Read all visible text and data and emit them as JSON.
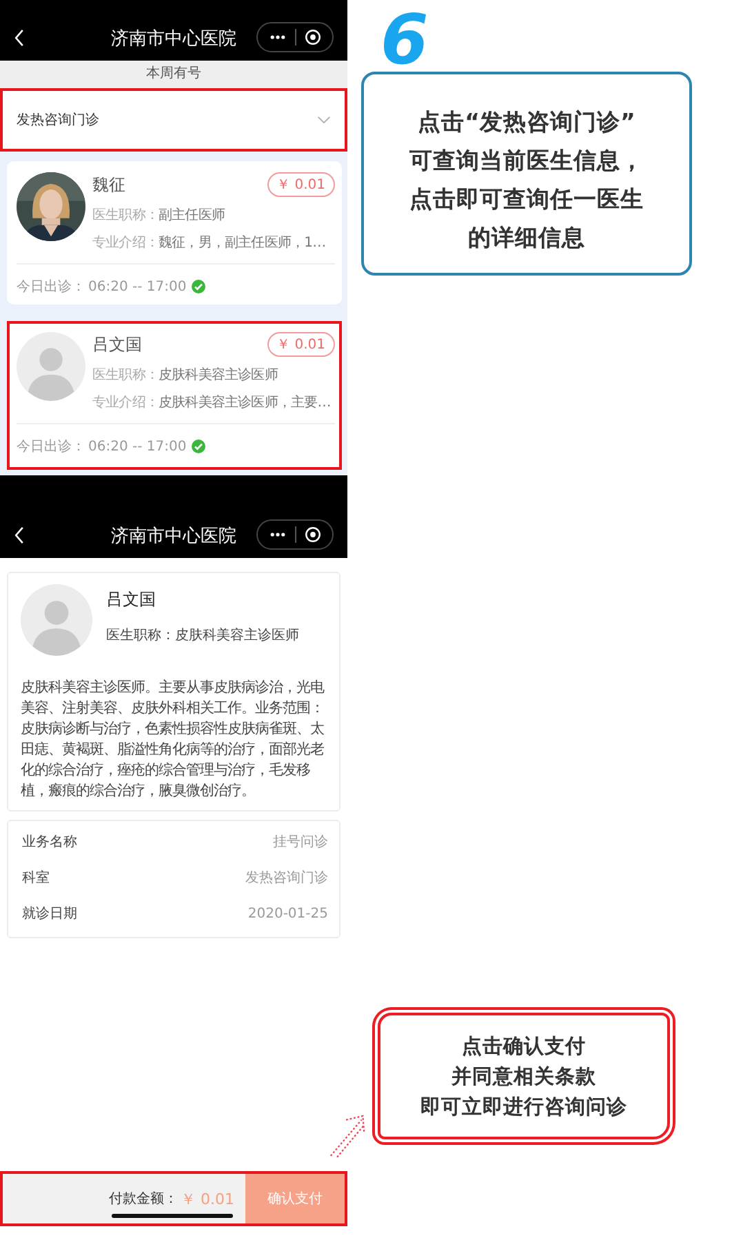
{
  "screens": [
    {
      "kind": "list",
      "nav_title": "济南市中心医院",
      "subheader": "本周有号",
      "dropdown": {
        "value": "发热咨询门诊",
        "highlighted": true
      },
      "doctors": [
        {
          "name": "魏征",
          "has_photo": true,
          "title_label": "医生职称：",
          "title": "副主任医师",
          "intro_label": "专业介绍：",
          "intro": "魏征，男，副主任医师，1…",
          "schedule_label": "今日出诊：",
          "schedule": "06:20 -- 17:00",
          "available": true,
          "price": "￥ 0.01",
          "highlighted": false
        },
        {
          "name": "吕文国",
          "has_photo": false,
          "title_label": "医生职称：",
          "title": "皮肤科美容主诊医师",
          "intro_label": "专业介绍：",
          "intro": "皮肤科美容主诊医师，主要…",
          "schedule_label": "今日出诊：",
          "schedule": "06:20 -- 17:00",
          "available": true,
          "price": "￥ 0.01",
          "highlighted": true
        }
      ]
    },
    {
      "kind": "detail",
      "nav_title": "济南市中心医院",
      "doctor": {
        "name": "吕文国",
        "has_photo": false,
        "title_label": "医生职称：",
        "title": "皮肤科美容主诊医师",
        "bio": "皮肤科美容主诊医师。主要从事皮肤病诊治，光电美容、注射美容、皮肤外科相关工作。业务范围：皮肤病诊断与治疗，色素性损容性皮肤病雀斑、太田痣、黄褐斑、脂溢性角化病等的治疗，面部光老化的综合治疗，痤疮的综合管理与治疗，毛发移植，瘢痕的综合治疗，腋臭微创治疗。"
      },
      "details": [
        {
          "label": "业务名称",
          "value": "挂号问诊"
        },
        {
          "label": "科室",
          "value": "发热咨询门诊"
        },
        {
          "label": "就诊日期",
          "value": "2020-01-25"
        }
      ],
      "payment": {
        "label": "付款金额：",
        "amount": "￥ 0.01",
        "button": "确认支付",
        "highlighted": true
      }
    }
  ],
  "callouts": [
    {
      "kind": "numbered",
      "number": "6",
      "lines": [
        "点击“发热咨询门诊”",
        "可查询当前医生信息，",
        "点击即可查询任一医生",
        "的详细信息"
      ]
    },
    {
      "kind": "scribble",
      "lines": [
        "点击确认支付",
        "并同意相关条款",
        "即可立即进行咨询问诊"
      ]
    }
  ]
}
